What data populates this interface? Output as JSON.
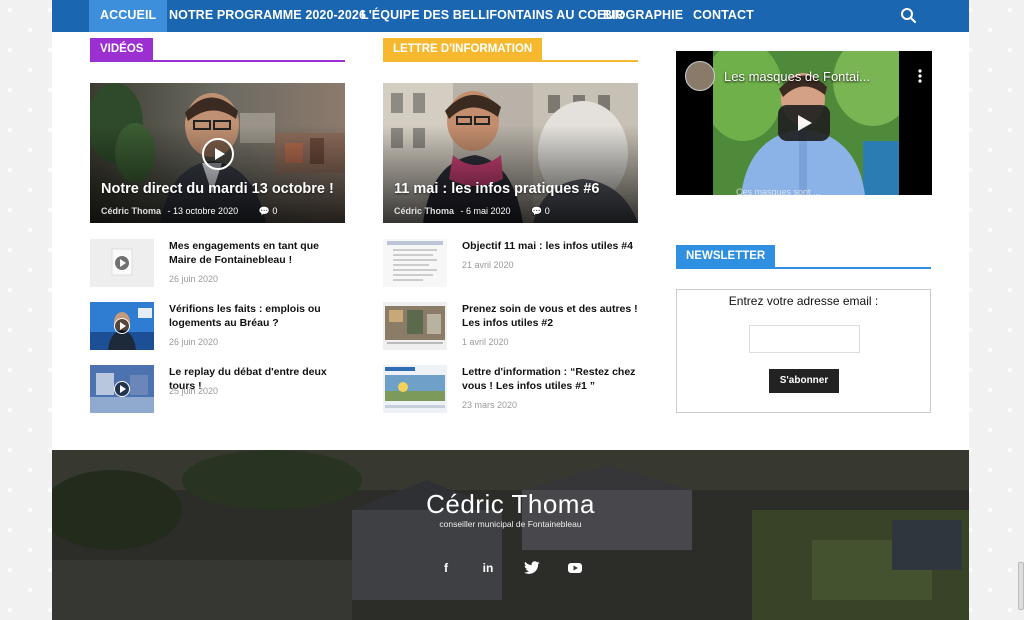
{
  "nav": {
    "items": [
      {
        "label": "ACCUEIL",
        "active": true
      },
      {
        "label": "NOTRE PROGRAMME 2020-2026",
        "active": false
      },
      {
        "label": "L'ÉQUIPE DES BELLIFONTAINS AU COEUR",
        "active": false
      },
      {
        "label": "BIOGRAPHIE",
        "active": false
      },
      {
        "label": "CONTACT",
        "active": false
      }
    ],
    "search_icon": "search-icon"
  },
  "videos": {
    "header": "VIDÉOS",
    "accent": "#9c2fcf",
    "feature": {
      "title": "Notre direct du mardi 13 octobre !",
      "author": "Cédric Thoma",
      "date": "13 octobre 2020",
      "comments": "0"
    },
    "items": [
      {
        "title": "Mes engagements en tant que Maire de Fontainebleau !",
        "date": "26 juin 2020"
      },
      {
        "title": "Vérifions les faits : emplois ou logements au Bréau ?",
        "date": "26 juin 2020"
      },
      {
        "title": "Le replay du débat d'entre deux tours !",
        "date": "25 juin 2020"
      }
    ]
  },
  "newsletter_letters": {
    "header": "LETTRE D'INFORMATION",
    "accent": "#f5b82e",
    "feature": {
      "title": "11 mai : les infos pratiques #6",
      "author": "Cédric Thoma",
      "date": "6 mai 2020",
      "comments": "0"
    },
    "items": [
      {
        "title": "Objectif 11 mai : les infos utiles #4",
        "date": "21 avril 2020"
      },
      {
        "title": "Prenez soin de vous et des autres ! Les infos utiles #2",
        "date": "1 avril 2020"
      },
      {
        "title": "Lettre d'information : “Restez chez vous ! Les infos utiles #1 ”",
        "date": "23 mars 2020"
      }
    ]
  },
  "youtube": {
    "title": "Les masques de Fontai...",
    "caption": "Ces masques sont ..."
  },
  "signup": {
    "header": "NEWSLETTER",
    "accent": "#2f8fe0",
    "label": "Entrez votre adresse email :",
    "input_value": "",
    "button": "S'abonner"
  },
  "footer": {
    "name": "Cédric Thoma",
    "subtitle": "conseiller municipal de Fontainebleau",
    "social": [
      {
        "icon": "facebook-icon",
        "glyph": "f"
      },
      {
        "icon": "linkedin-icon",
        "glyph": "in"
      },
      {
        "icon": "twitter-icon",
        "glyph": ""
      },
      {
        "icon": "youtube-icon",
        "glyph": ""
      }
    ]
  }
}
